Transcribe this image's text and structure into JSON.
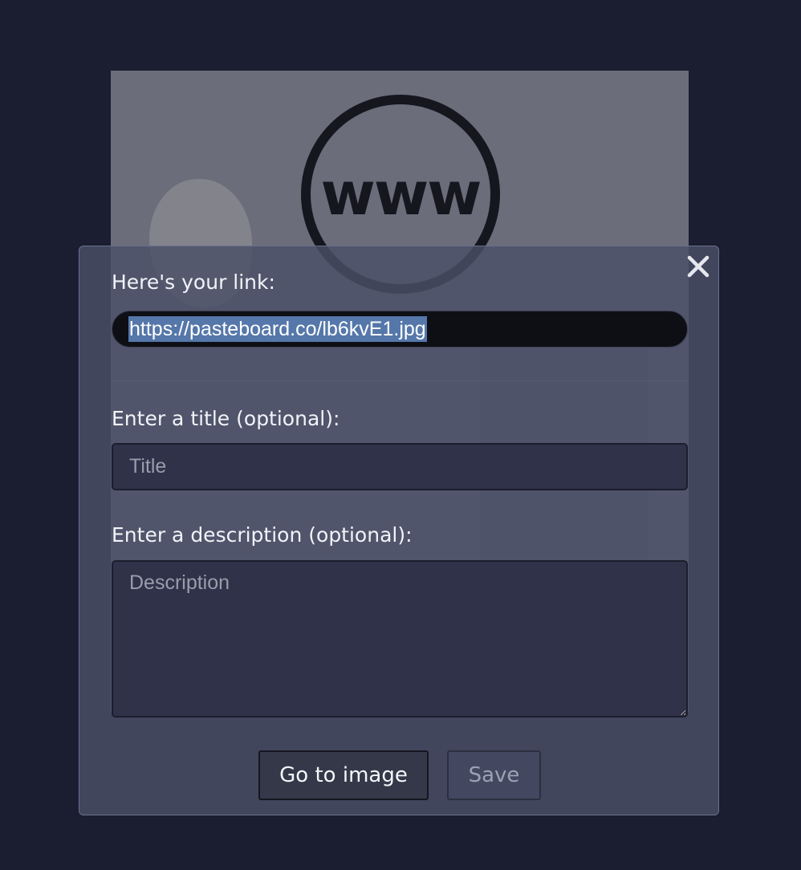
{
  "preview": {
    "logo_text": "www"
  },
  "dialog": {
    "link_label": "Here's your link:",
    "link_value": "https://pasteboard.co/lb6kvE1.jpg",
    "title_label": "Enter a title (optional):",
    "title_placeholder": "Title",
    "title_value": "",
    "description_label": "Enter a description (optional):",
    "description_placeholder": "Description",
    "description_value": "",
    "go_to_image_label": "Go to image",
    "save_label": "Save"
  },
  "icons": {
    "close": "close-icon"
  },
  "colors": {
    "page_background": "#1b1d30",
    "dialog_background": "#4a4f68",
    "link_field_background": "#0e0f15",
    "selection_highlight": "#5577aa"
  }
}
